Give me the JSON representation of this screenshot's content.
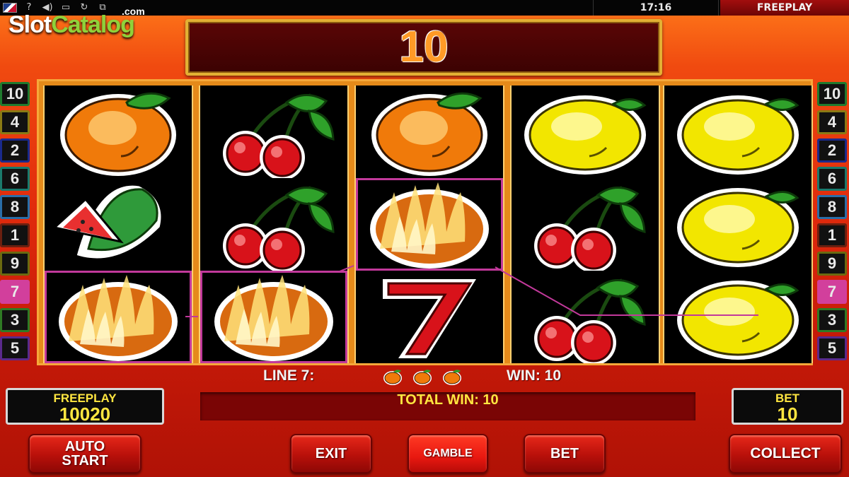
{
  "status_bar": {
    "icons": [
      "uk-flag-icon",
      "help-icon",
      "sound-icon",
      "fullscreen-icon",
      "refresh-icon",
      "window-icon"
    ],
    "clock": "17:16",
    "mode": "FREEPLAY"
  },
  "watermark": {
    "name_part1": "Slot",
    "name_part2": "Catalog",
    "suffix": ".com"
  },
  "win_display": "10",
  "reels": [
    [
      "orange",
      "watermelon",
      "orange-burning"
    ],
    [
      "cherry",
      "cherry",
      "orange-burning"
    ],
    [
      "orange",
      "orange-burning",
      "seven"
    ],
    [
      "lemon",
      "cherry",
      "cherry"
    ],
    [
      "lemon",
      "lemon",
      "lemon"
    ]
  ],
  "highlighted_cells": [
    [
      0,
      2
    ],
    [
      1,
      2
    ],
    [
      2,
      1
    ]
  ],
  "line_badges_left": [
    {
      "num": "10",
      "color": "#1f7a2e"
    },
    {
      "num": "4",
      "color": "#8a7a14"
    },
    {
      "num": "2",
      "color": "#1a2a8c"
    },
    {
      "num": "6",
      "color": "#1b7a6c"
    },
    {
      "num": "8",
      "color": "#2a6ea8"
    },
    {
      "num": "1",
      "color": "#6b2010"
    },
    {
      "num": "9",
      "color": "#6b6a10"
    },
    {
      "num": "7",
      "color": "#d23f9c"
    },
    {
      "num": "3",
      "color": "#2f7a24"
    },
    {
      "num": "5",
      "color": "#5a2a8c"
    }
  ],
  "line_badges_right": [
    {
      "num": "10",
      "color": "#1f7a2e"
    },
    {
      "num": "4",
      "color": "#8a7a14"
    },
    {
      "num": "2",
      "color": "#1a2a8c"
    },
    {
      "num": "6",
      "color": "#1b7a6c"
    },
    {
      "num": "8",
      "color": "#2a6ea8"
    },
    {
      "num": "1",
      "color": "#6b2010"
    },
    {
      "num": "9",
      "color": "#6b6a10"
    },
    {
      "num": "7",
      "color": "#d23f9c"
    },
    {
      "num": "3",
      "color": "#2f7a24"
    },
    {
      "num": "5",
      "color": "#5a2a8c"
    }
  ],
  "line_info": {
    "label": "LINE 7:",
    "win": "WIN: 10",
    "symbols": [
      "orange",
      "orange",
      "orange"
    ]
  },
  "total_win": "TOTAL WIN: 10",
  "freeplay_meter": {
    "label": "FREEPLAY",
    "value": "10020"
  },
  "bet_meter": {
    "label": "BET",
    "value": "10"
  },
  "buttons": {
    "auto_start_line1": "AUTO",
    "auto_start_line2": "START",
    "exit": "EXIT",
    "gamble": "GAMBLE",
    "bet": "BET",
    "collect": "COLLECT"
  },
  "colors": {
    "payline": "#c2399b",
    "win_text": "#ff9a26",
    "meter_text": "#ffe640"
  }
}
